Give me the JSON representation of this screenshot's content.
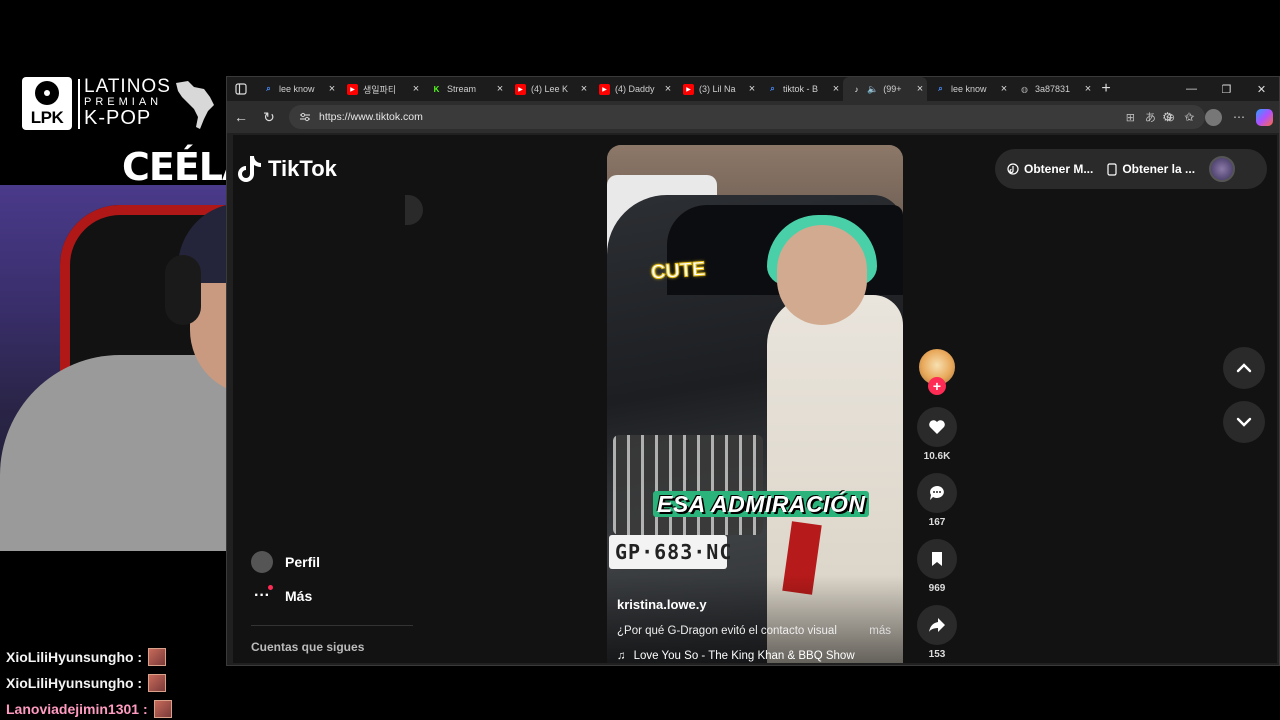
{
  "overlay": {
    "logo_badge": "LPK",
    "logo_line1": "LATINOS",
    "logo_line2": "PREMIAN",
    "logo_line3": "K-POP",
    "streamer_name": "CEÉLA",
    "platform_label": "TikTok"
  },
  "browser": {
    "tabs": [
      {
        "title": "lee know",
        "icon": "search-icon",
        "color": "#4a8cff"
      },
      {
        "title": "생일파티",
        "icon": "youtube-icon",
        "color": "#ff0000"
      },
      {
        "title": "Stream",
        "icon": "kick-icon",
        "color": "#53fc18"
      },
      {
        "title": "(4) Lee K",
        "icon": "youtube-icon",
        "color": "#ff0000"
      },
      {
        "title": "(4) Daddy",
        "icon": "youtube-icon",
        "color": "#ff0000"
      },
      {
        "title": "(3) Lil Na",
        "icon": "youtube-icon",
        "color": "#ff0000"
      },
      {
        "title": "tiktok - B",
        "icon": "search-icon",
        "color": "#4a8cff"
      },
      {
        "title": "(99+",
        "icon": "tiktok-icon",
        "color": "#ffffff",
        "active": true
      },
      {
        "title": "lee know",
        "icon": "search-icon",
        "color": "#4a8cff"
      },
      {
        "title": "3a87831",
        "icon": "globe-icon",
        "color": "#aaaaaa"
      }
    ],
    "url": "https://www.tiktok.com"
  },
  "tiktok": {
    "sidebar": {
      "profile_label": "Perfil",
      "more_label": "Más",
      "following_label": "Cuentas que sigues"
    },
    "header": {
      "get_app_label": "Obtener M...",
      "get_desktop_label": "Obtener la ..."
    },
    "video": {
      "overlay_word": "CUTE",
      "caption_text": "ESA ADMIRACIÓN",
      "plate_text": "GP·683·NC",
      "author": "kristina.lowe.y",
      "description": "¿Por qué G-Dragon evitó el contacto visual",
      "more_label": "más",
      "music": "Love You So - The King Khan & BBQ Show"
    },
    "actions": {
      "likes": "10.6K",
      "comments": "167",
      "saves": "969",
      "shares": "153"
    }
  },
  "chat": [
    {
      "name": "XioLiliHyunsungho :",
      "color": "#f4f4f4"
    },
    {
      "name": "XioLiliHyunsungho :",
      "color": "#f4f4f4"
    },
    {
      "name": "Lanoviadejimin1301 :",
      "color": "#ff9ac0"
    }
  ]
}
